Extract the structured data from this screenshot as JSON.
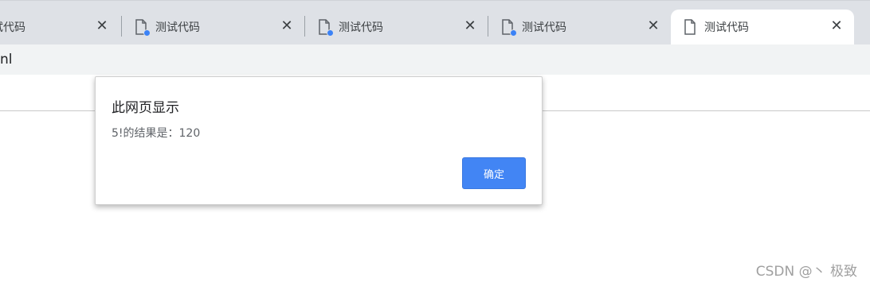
{
  "browser": {
    "tabs": [
      {
        "title": "试代码",
        "close": "✕"
      },
      {
        "title": "测试代码",
        "close": "✕"
      },
      {
        "title": "测试代码",
        "close": "✕"
      },
      {
        "title": "测试代码",
        "close": "✕"
      },
      {
        "title": "测试代码",
        "close": "✕"
      }
    ],
    "address_text": "nl"
  },
  "dialog": {
    "title": "此网页显示",
    "message": "5!的结果是：120",
    "ok_label": "确定"
  },
  "watermark": "CSDN @丶 极致",
  "colors": {
    "tabstrip": "#dee1e6",
    "active_tab": "#ffffff",
    "button_primary": "#4285f4",
    "loading_dot": "#3b82f6"
  }
}
